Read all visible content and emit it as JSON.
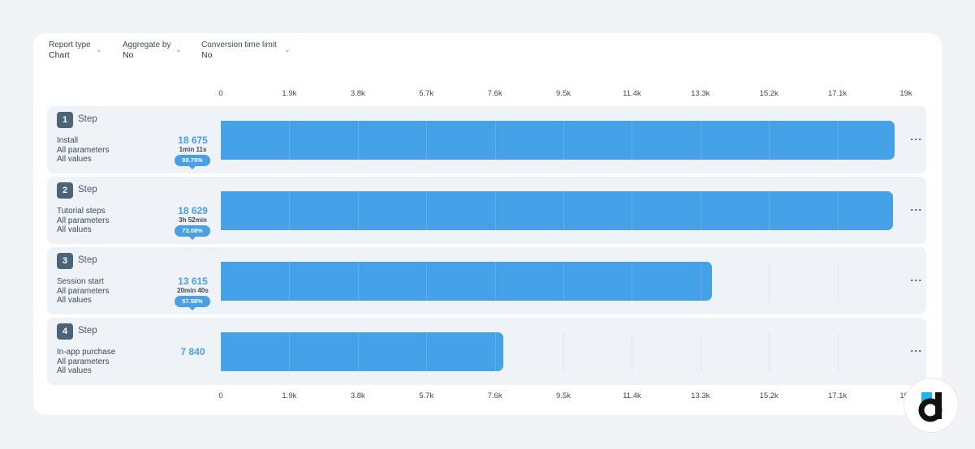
{
  "filters": [
    {
      "label": "Report type",
      "value": "Chart"
    },
    {
      "label": "Aggregate by",
      "value": "No"
    },
    {
      "label": "Conversion time limit",
      "value": "No"
    }
  ],
  "colors": {
    "bar": "#46a2e8",
    "accent": "#4aa0e6",
    "step_badge": "#4c6378",
    "row_bg": "#eff2f6"
  },
  "chart_data": {
    "type": "bar",
    "orientation": "horizontal",
    "xlim": [
      0,
      19000
    ],
    "tick_labels": [
      "0",
      "1.9k",
      "3.8k",
      "5.7k",
      "7.6k",
      "9.5k",
      "11.4k",
      "13.3k",
      "15.2k",
      "17.1k",
      "19k"
    ],
    "categories": [
      "Install",
      "Tutorial steps",
      "Session start",
      "In-app purchase"
    ],
    "values": [
      18675,
      18629,
      13615,
      7840
    ]
  },
  "steps": [
    {
      "num": "1",
      "label": "Step",
      "event": "Install",
      "params": "All parameters",
      "vals": "All values",
      "count": "18 675",
      "value": 18675,
      "time": "1min 11s",
      "pct": "99.75%"
    },
    {
      "num": "2",
      "label": "Step",
      "event": "Tutorial steps",
      "params": "All parameters",
      "vals": "All values",
      "count": "18 629",
      "value": 18629,
      "time": "3h 52min",
      "pct": "73.08%"
    },
    {
      "num": "3",
      "label": "Step",
      "event": "Session start",
      "params": "All parameters",
      "vals": "All values",
      "count": "13 615",
      "value": 13615,
      "time": "20min 40s",
      "pct": "57.58%"
    },
    {
      "num": "4",
      "label": "Step",
      "event": "In-app purchase",
      "params": "All parameters",
      "vals": "All values",
      "count": "7 840",
      "value": 7840,
      "time": "",
      "pct": ""
    }
  ]
}
